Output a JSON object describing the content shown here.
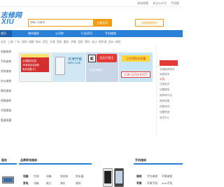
{
  "topbar": {
    "links": [
      "网站地图",
      "关注公众号",
      "手机版"
    ]
  },
  "logo": {
    "top": "志修网",
    "sub": "XIU"
  },
  "search": {
    "placeholder": "请输入关键词",
    "button": "在看买家",
    "quick": "加盟维修服务"
  },
  "nav": {
    "items": [
      "首页",
      "城市服务",
      "公司库",
      "行业资讯",
      "手机维修"
    ]
  },
  "cities": {
    "items": [
      "北京",
      "上海",
      "广州",
      "深圳",
      "成都",
      "杭州",
      "武汉",
      "天津",
      "西安",
      "重庆",
      "济南",
      "沈阳",
      "郑州",
      "长沙",
      "哈尔滨",
      "苏州",
      "南京"
    ]
  },
  "sidebar": {
    "items": [
      "电脑维修",
      "手机维修",
      "家电维修",
      "办公维修",
      "数码维修",
      "网络维修",
      "开锁换锁",
      "管道疏通",
      "维修"
    ]
  },
  "banners": {
    "b1": {
      "lines": [
        "乡镇服务站招",
        "38家居全包装修",
        "免费加盟(订)"
      ]
    },
    "b2": {
      "title": "天津开锁",
      "sub": "8899-2286"
    },
    "b3": {
      "k": "K",
      "title": "优先开锁王",
      "sub": "专业开锁服务"
    },
    "b4": {
      "title": "卫生间防水补漏",
      "phone": "138-1250-6357"
    }
  },
  "side_login": {
    "lines": [
      "全国维修服务",
      "免费发布",
      "注册会员",
      "加盟服务",
      "维修网平台",
      "维修技能",
      "技能培训",
      "加盟商家",
      "会员中心"
    ],
    "title": "公告"
  },
  "sections": {
    "left_title": "服务",
    "mid_title": "品牌家电维修",
    "mid2_title": "品牌维修",
    "right_title": "手机维修"
  },
  "appliance": {
    "row1": [
      "空调",
      "冰箱",
      "洗衣机",
      "热水器"
    ],
    "row2": [
      "冰箱",
      "格力",
      "海尔",
      "美的"
    ],
    "col_left": [
      "电脑",
      "家电"
    ]
  },
  "phones": {
    "row1": [
      "维修",
      "华为维修",
      "苹果维修"
    ],
    "row2": [
      "苹果",
      "苹果手机",
      "vivo手机"
    ]
  }
}
